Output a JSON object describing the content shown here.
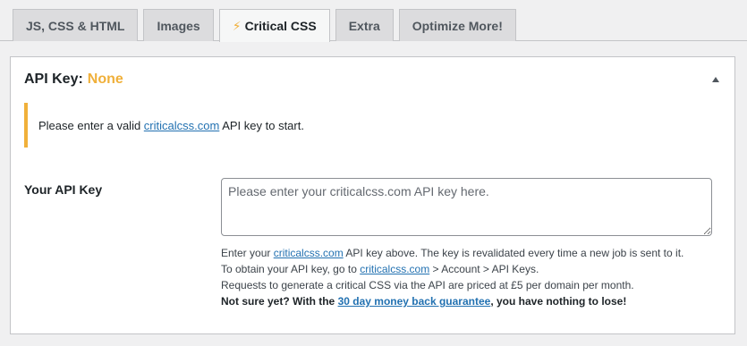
{
  "tabs": [
    {
      "label": "JS, CSS & HTML"
    },
    {
      "label": "Images"
    },
    {
      "label": "Critical CSS",
      "icon": "lightning-icon",
      "active": true
    },
    {
      "label": "Extra"
    },
    {
      "label": "Optimize More!"
    }
  ],
  "panel": {
    "title_prefix": "API Key:",
    "status": "None",
    "status_color": "#f0b03a"
  },
  "notice": {
    "text_before": "Please enter a valid ",
    "link": "criticalcss.com",
    "text_after": " API key to start."
  },
  "api_field": {
    "label": "Your API Key",
    "placeholder": "Please enter your criticalcss.com API key here.",
    "value": ""
  },
  "description": {
    "line1_before": "Enter your ",
    "line1_link": "criticalcss.com",
    "line1_after": " API key above. The key is revalidated every time a new job is sent to it.",
    "line2_before": "To obtain your API key, go to ",
    "line2_link": "criticalcss.com",
    "line2_after": " > Account > API Keys.",
    "line3": "Requests to generate a critical CSS via the API are priced at £5 per domain per month.",
    "line4_before": "Not sure yet? With the ",
    "line4_link": "30 day money back guarantee",
    "line4_after": ", you have nothing to lose!"
  },
  "colors": {
    "accent": "#f0b03a",
    "link": "#2271b1"
  }
}
